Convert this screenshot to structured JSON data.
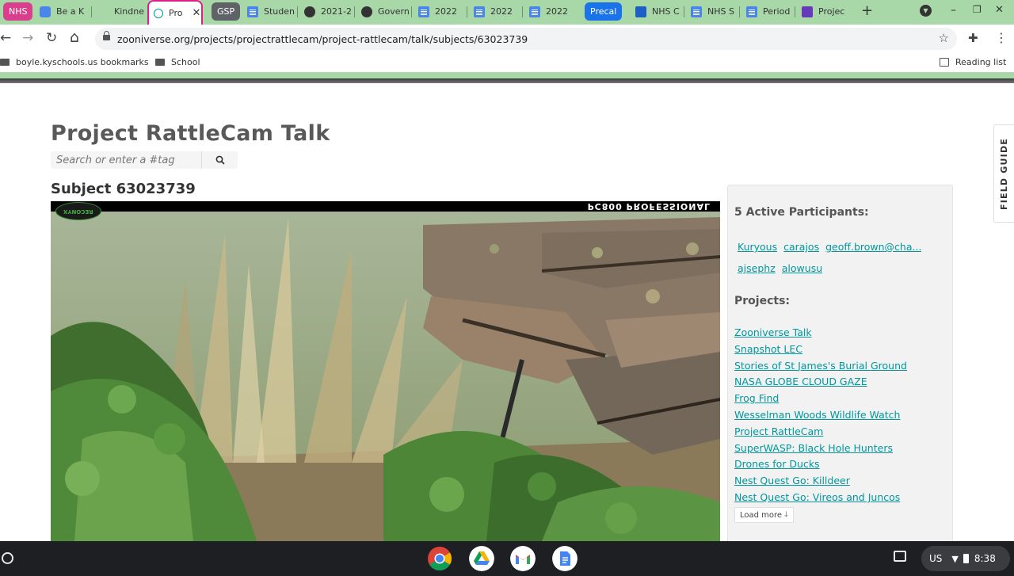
{
  "tabs": [
    {
      "label": "NHS",
      "type": "group",
      "color": "#d93f8c"
    },
    {
      "label": "Be a K",
      "icon": "bitmoji-icon"
    },
    {
      "label": "Kindne",
      "icon": "blank-icon"
    },
    {
      "label": "Pro",
      "icon": "zooniverse-icon",
      "active": true
    },
    {
      "label": "GSP",
      "type": "group",
      "color": "#5f6368"
    },
    {
      "label": "Studen",
      "icon": "docs-icon"
    },
    {
      "label": "2021-2",
      "icon": "globe-icon"
    },
    {
      "label": "Govern",
      "icon": "globe-icon"
    },
    {
      "label": "2022",
      "icon": "docs-icon"
    },
    {
      "label": "2022",
      "icon": "docs-icon"
    },
    {
      "label": "2022",
      "icon": "docs-icon"
    },
    {
      "label": "Precal",
      "type": "group",
      "color": "#1a73e8"
    },
    {
      "label": "NHS C",
      "icon": "classroom-icon"
    },
    {
      "label": "NHS S",
      "icon": "docs-icon"
    },
    {
      "label": "Period",
      "icon": "docs-icon"
    },
    {
      "label": "Projec",
      "icon": "forms-icon"
    }
  ],
  "browser": {
    "url": "zooniverse.org/projects/projectrattlecam/project-rattlecam/talk/subjects/63023739",
    "bookmarks": [
      {
        "label": "boyle.kyschools.us bookmarks"
      },
      {
        "label": "School"
      }
    ],
    "reading_list": "Reading list"
  },
  "page": {
    "title": "Project RattleCam Talk",
    "search_placeholder": "Search or enter a #tag",
    "subject_title": "Subject 63023739",
    "camera_header": "PC800 PROFESSIONAL",
    "camera_logo": "RECONYX",
    "field_guide": "FIELD GUIDE"
  },
  "sidebar": {
    "participants_heading": "5 Active Participants:",
    "participants": [
      "Kuryous",
      "carajos",
      "geoff.brown@cha...",
      "ajsephz",
      "alowusu"
    ],
    "projects_heading": "Projects:",
    "projects": [
      "Zooniverse Talk",
      "Snapshot LEC",
      "Stories of St James's Burial Ground",
      "NASA GLOBE CLOUD GAZE ",
      "Frog Find",
      "Wesselman Woods Wildlife Watch",
      "Project RattleCam ",
      "SuperWASP: Black Hole Hunters",
      "Drones for Ducks",
      "Nest Quest Go: Killdeer",
      "Nest Quest Go: Vireos and Juncos"
    ],
    "load_more": "Load more"
  },
  "shelf": {
    "apps": [
      "chrome-icon",
      "drive-icon",
      "gmail-icon",
      "docs-icon"
    ],
    "locale": "US",
    "time": "8:38"
  },
  "colors": {
    "tab_bar": "#a8d8a8",
    "link": "#00979d",
    "heading": "#595959"
  }
}
